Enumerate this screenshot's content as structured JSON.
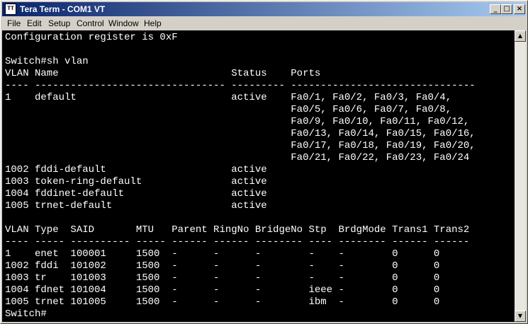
{
  "window": {
    "title": "Tera Term - COM1 VT",
    "icon_label": "TT"
  },
  "menu": [
    {
      "label": "File"
    },
    {
      "label": "Edit"
    },
    {
      "label": "Setup"
    },
    {
      "label": "Control"
    },
    {
      "label": "Window"
    },
    {
      "label": "Help"
    }
  ],
  "terminal": {
    "lines": [
      "Configuration register is 0xF",
      "",
      "Switch#sh vlan",
      "VLAN Name                             Status    Ports",
      "---- -------------------------------- --------- -------------------------------",
      "1    default                          active    Fa0/1, Fa0/2, Fa0/3, Fa0/4,",
      "                                                Fa0/5, Fa0/6, Fa0/7, Fa0/8,",
      "                                                Fa0/9, Fa0/10, Fa0/11, Fa0/12,",
      "                                                Fa0/13, Fa0/14, Fa0/15, Fa0/16,",
      "                                                Fa0/17, Fa0/18, Fa0/19, Fa0/20,",
      "                                                Fa0/21, Fa0/22, Fa0/23, Fa0/24",
      "1002 fddi-default                     active",
      "1003 token-ring-default               active",
      "1004 fddinet-default                  active",
      "1005 trnet-default                    active",
      "",
      "VLAN Type  SAID       MTU   Parent RingNo BridgeNo Stp  BrdgMode Trans1 Trans2",
      "---- ----- ---------- ----- ------ ------ -------- ---- -------- ------ ------",
      "1    enet  100001     1500  -      -      -        -    -        0      0",
      "1002 fddi  101002     1500  -      -      -        -    -        0      0",
      "1003 tr    101003     1500  -      -      -        -    -        0      0",
      "1004 fdnet 101004     1500  -      -      -        ieee -        0      0",
      "1005 trnet 101005     1500  -      -      -        ibm  -        0      0",
      "Switch#"
    ]
  }
}
